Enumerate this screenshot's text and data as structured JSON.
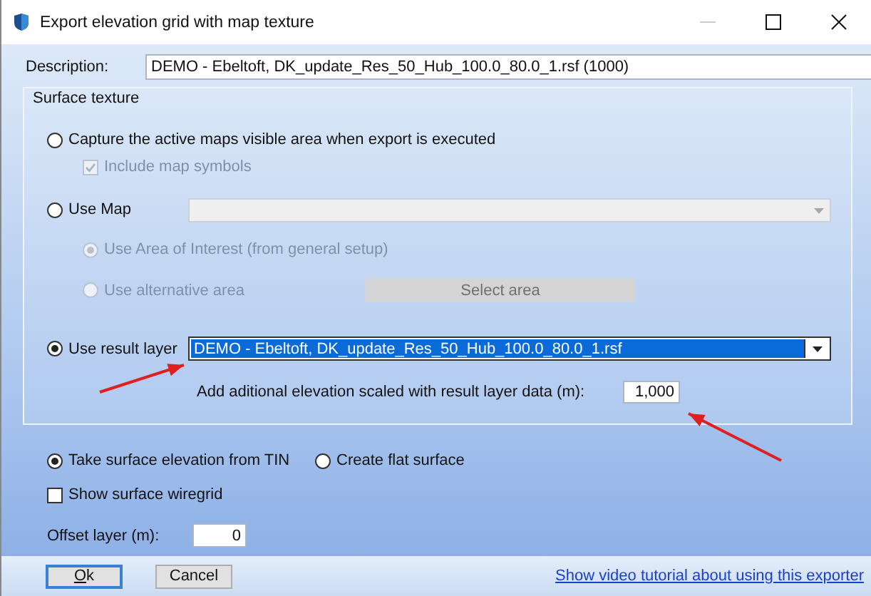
{
  "window": {
    "title": "Export elevation grid with map texture"
  },
  "description": {
    "label": "Description:",
    "value": "DEMO - Ebeltoft, DK_update_Res_50_Hub_100.0_80.0_1.rsf (1000)"
  },
  "surface_texture": {
    "title": "Surface texture",
    "capture": {
      "label": "Capture the active maps visible area when export is executed",
      "selected": false,
      "include_symbols": {
        "label": "Include map symbols",
        "checked": true,
        "disabled": true
      }
    },
    "use_map": {
      "label": "Use Map",
      "selected": false,
      "dropdown": {
        "disabled": true
      }
    },
    "area_options": [
      {
        "label": "Use Area of Interest (from general setup)",
        "selected": true,
        "disabled": true
      },
      {
        "label": "Use alternative area",
        "selected": false,
        "disabled": true
      }
    ],
    "select_area_button": {
      "label": "Select area",
      "disabled": true
    },
    "result_layer": {
      "label": "Use result layer",
      "selected": true,
      "dropdown": {
        "value": "DEMO - Ebeltoft, DK_update_Res_50_Hub_100.0_80.0_1.rsf",
        "focused": true
      }
    },
    "additional_elevation": {
      "label": "Add aditional elevation scaled with result layer data (m):",
      "value": "1,000"
    }
  },
  "surface_elevation": [
    {
      "label": "Take surface elevation from TIN",
      "selected": true
    },
    {
      "label": "Create flat surface",
      "selected": false
    }
  ],
  "show_wiregrid": {
    "label": "Show surface wiregrid",
    "checked": false
  },
  "offset_layer": {
    "label": "Offset layer (m):",
    "value": "0"
  },
  "buttons": [
    {
      "label": "Ok",
      "focused": true
    },
    {
      "label": "Cancel",
      "focused": false
    }
  ],
  "tutorial_link": "Show video tutorial about using this exporter"
}
